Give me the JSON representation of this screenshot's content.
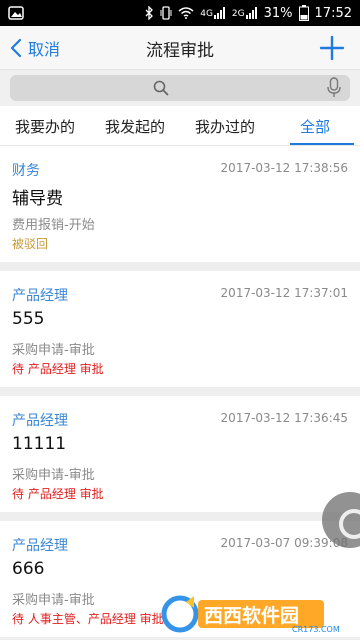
{
  "status_bar": {
    "network_4g": "4G",
    "network_2g": "2G",
    "battery": "31%",
    "time": "17:52"
  },
  "nav": {
    "back_label": "取消",
    "title": "流程审批",
    "add_icon": "plus-icon"
  },
  "search": {
    "placeholder": ""
  },
  "tabs": [
    {
      "label": "我要办的",
      "active": false
    },
    {
      "label": "我发起的",
      "active": false
    },
    {
      "label": "我办过的",
      "active": false
    },
    {
      "label": "全部",
      "active": true
    }
  ],
  "items": [
    {
      "category": "财务",
      "time": "2017-03-12 17:38:56",
      "title": "辅导费",
      "process": "费用报销-开始",
      "status": "被驳回",
      "status_color": "#c89a3a"
    },
    {
      "category": "产品经理",
      "time": "2017-03-12 17:37:01",
      "title": "555",
      "process": "采购申请-审批",
      "status": "待 产品经理 审批",
      "status_color": "#e02020"
    },
    {
      "category": "产品经理",
      "time": "2017-03-12 17:36:45",
      "title": "11111",
      "process": "采购申请-审批",
      "status": "待 产品经理 审批",
      "status_color": "#e02020"
    },
    {
      "category": "产品经理",
      "time": "2017-03-07 09:39:08",
      "title": "666",
      "process": "采购申请-审批",
      "status": "待 人事主管、产品经理 审批",
      "status_color": "#e02020"
    }
  ],
  "watermark": {
    "brand": "西西软件园",
    "domain": "CR173.COM"
  },
  "colors": {
    "accent": "#1f7ae0",
    "category": "#3a86d4",
    "rejected": "#c89a3a",
    "pending": "#e02020"
  }
}
